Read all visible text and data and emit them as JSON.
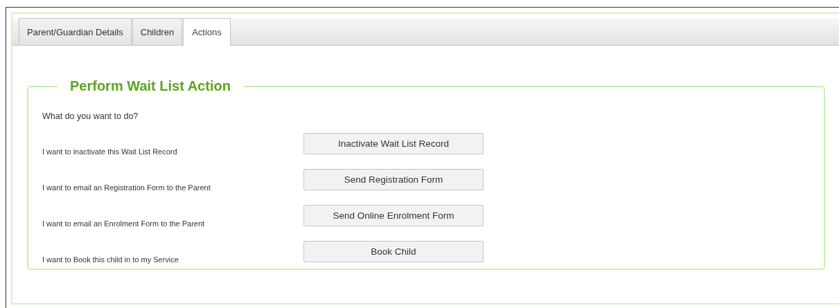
{
  "tabs": [
    {
      "label": "Parent/Guardian Details",
      "selected": false
    },
    {
      "label": "Children",
      "selected": false
    },
    {
      "label": "Actions",
      "selected": true
    }
  ],
  "panel": {
    "title": "Perform Wait List Action",
    "question": "What do you want to do?",
    "actions": [
      {
        "description": "I want to inactivate this Wait List Record",
        "button": "Inactivate Wait List Record"
      },
      {
        "description": "I want to email an Registration Form to the Parent",
        "button": "Send Registration Form"
      },
      {
        "description": "I want to email an Enrolment Form to the Parent",
        "button": "Send Online Enrolment Form"
      },
      {
        "description": "I want to Book this child in to my Service",
        "button": "Book Child"
      }
    ]
  }
}
